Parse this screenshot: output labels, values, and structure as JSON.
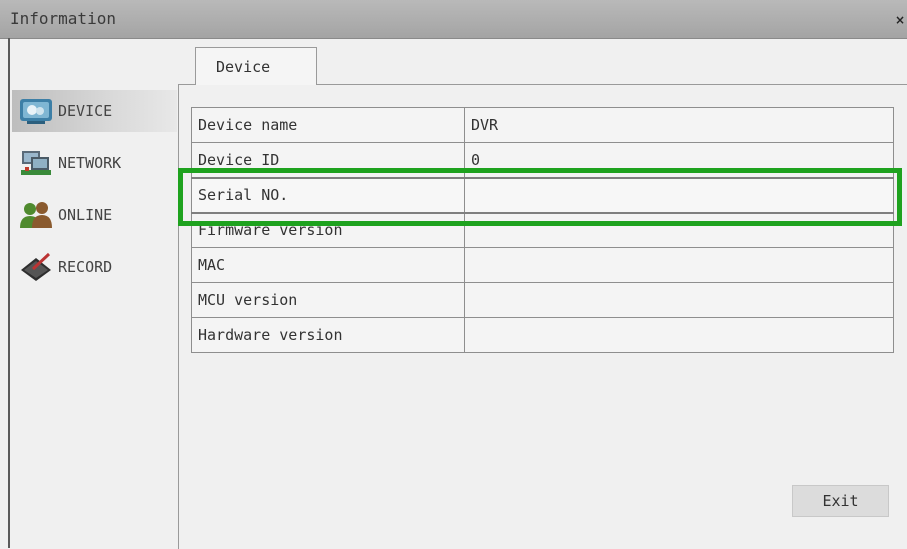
{
  "window": {
    "title": "Information",
    "close_symbol": "×"
  },
  "sidebar": {
    "items": [
      {
        "label": "DEVICE",
        "icon": "device-icon",
        "active": true
      },
      {
        "label": "NETWORK",
        "icon": "network-icon",
        "active": false
      },
      {
        "label": "ONLINE",
        "icon": "users-icon",
        "active": false
      },
      {
        "label": "RECORD",
        "icon": "record-icon",
        "active": false
      }
    ]
  },
  "tab": {
    "label": "Device"
  },
  "table": {
    "rows": [
      {
        "label": "Device name",
        "value": "DVR"
      },
      {
        "label": "Device ID",
        "value": "0"
      },
      {
        "label": "Serial NO.",
        "value": ""
      },
      {
        "label": "Firmware version",
        "value": ""
      },
      {
        "label": "MAC",
        "value": ""
      },
      {
        "label": "MCU version",
        "value": ""
      },
      {
        "label": "Hardware version",
        "value": ""
      }
    ]
  },
  "buttons": {
    "exit": "Exit"
  },
  "colors": {
    "highlight": "#1ea21e",
    "titlebar": "#b0b0b0",
    "background": "#f0f0f0"
  }
}
